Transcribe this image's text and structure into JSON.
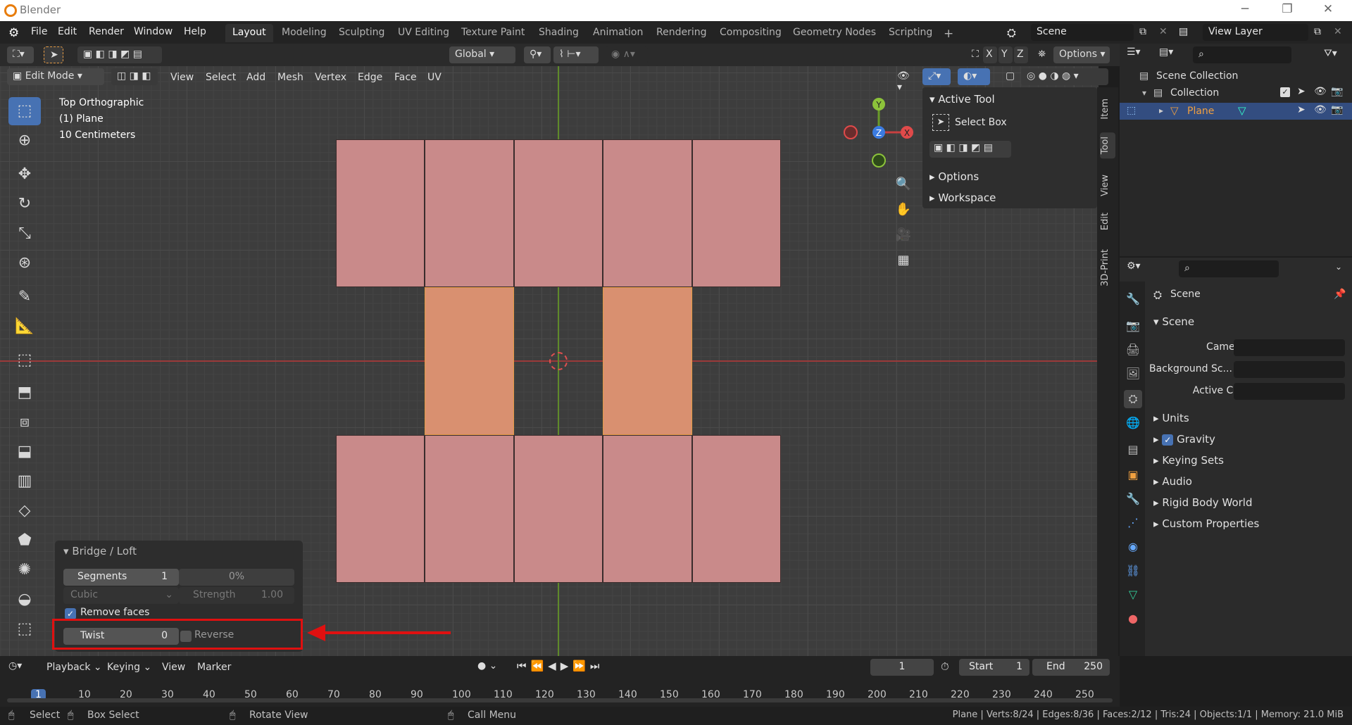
{
  "window": {
    "title": "Blender"
  },
  "menu": [
    "File",
    "Edit",
    "Render",
    "Window",
    "Help"
  ],
  "workspaces": [
    "Layout",
    "Modeling",
    "Sculpting",
    "UV Editing",
    "Texture Paint",
    "Shading",
    "Animation",
    "Rendering",
    "Compositing",
    "Geometry Nodes",
    "Scripting"
  ],
  "active_workspace": "Layout",
  "scene_field": "Scene",
  "view_layer_field": "View Layer",
  "viewport_header": {
    "orientation": "Global",
    "axes": [
      "X",
      "Y",
      "Z"
    ],
    "options_label": "Options",
    "mode": "Edit Mode",
    "menus": [
      "View",
      "Select",
      "Add",
      "Mesh",
      "Vertex",
      "Edge",
      "Face",
      "UV"
    ]
  },
  "overlay_text": {
    "view": "Top Orthographic",
    "object": "(1) Plane",
    "scale": "10 Centimeters"
  },
  "gizmo": {
    "y": "Y",
    "z": "Z",
    "x": "X"
  },
  "npanel": {
    "active_tool_label": "Active Tool",
    "tool_name": "Select Box",
    "options_label": "Options",
    "workspace_label": "Workspace",
    "tabs": [
      "Item",
      "Tool",
      "View",
      "Edit",
      "3D-Print"
    ]
  },
  "operator": {
    "title": "Bridge / Loft",
    "segments_label": "Segments",
    "segments_value": "1",
    "smoothness_value": "0%",
    "interp_label": "Cubic",
    "strength_label": "Strength",
    "strength_value": "1.00",
    "remove_faces_label": "Remove faces",
    "twist_label": "Twist",
    "twist_value": "0",
    "reverse_label": "Reverse"
  },
  "outliner": {
    "scene_collection": "Scene Collection",
    "collection": "Collection",
    "object": "Plane"
  },
  "properties": {
    "header": "Scene",
    "section": "Scene",
    "camera_label": "Camera",
    "background_label": "Background Sc...",
    "active_clip_label": "Active Clip",
    "panels": [
      "Units",
      "Gravity",
      "Keying Sets",
      "Audio",
      "Rigid Body World",
      "Custom Properties"
    ]
  },
  "timeline": {
    "menus": [
      "Playback",
      "Keying",
      "View",
      "Marker"
    ],
    "current_frame": "1",
    "start_label": "Start",
    "start_value": "1",
    "end_label": "End",
    "end_value": "250",
    "ticks": [
      "1",
      "10",
      "20",
      "30",
      "40",
      "50",
      "60",
      "70",
      "80",
      "90",
      "100",
      "110",
      "120",
      "130",
      "140",
      "150",
      "160",
      "170",
      "180",
      "190",
      "200",
      "210",
      "220",
      "230",
      "240",
      "250"
    ]
  },
  "statusbar": {
    "select": "Select",
    "box_select": "Box Select",
    "rotate_view": "Rotate View",
    "call_menu": "Call Menu",
    "stats": "Plane | Verts:8/24 | Edges:8/36 | Faces:2/12 | Tris:24 | Objects:1/1 | Memory: 21.0 MiB"
  },
  "colors": {
    "accent": "#4772b3",
    "face": "#c98a8a",
    "face_selected": "#d99070",
    "highlight": "#e01010"
  }
}
